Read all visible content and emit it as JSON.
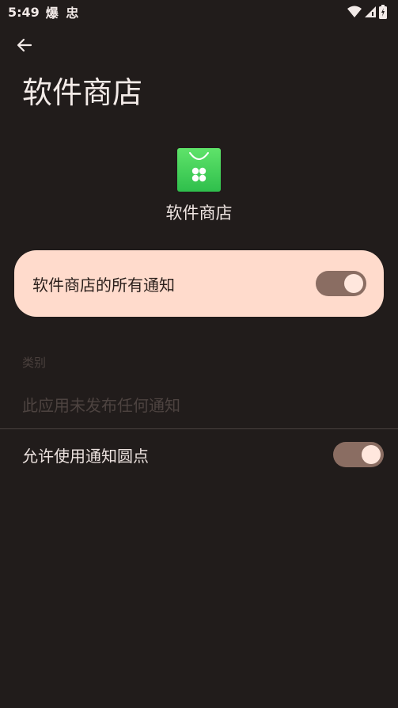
{
  "status_bar": {
    "time": "5:49",
    "app_indicator": "爆 忠",
    "icons": [
      "wifi-icon",
      "signal-icon",
      "battery-icon"
    ]
  },
  "header": {
    "title": "软件商店"
  },
  "app": {
    "name": "软件商店",
    "icon": "app-store-bag-icon",
    "icon_color": "#3fcf55"
  },
  "all_notifications": {
    "label": "软件商店的所有通知",
    "enabled": true
  },
  "categories": {
    "header": "类别",
    "empty_text": "此应用未发布任何通知"
  },
  "notification_dot": {
    "label": "允许使用通知圆点",
    "enabled": true
  },
  "colors": {
    "background": "#211c1b",
    "card": "#ffdbcc",
    "toggle_track": "#8a6d62",
    "toggle_thumb": "#ffe7dd"
  }
}
